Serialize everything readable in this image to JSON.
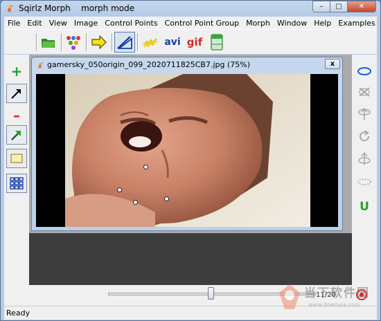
{
  "window": {
    "app_name": "Sqirlz Morph",
    "mode": "morph mode",
    "buttons": {
      "minimize": "–",
      "maximize": "□",
      "close": "✕"
    }
  },
  "menu": [
    "File",
    "Edit",
    "View",
    "Image",
    "Control Points",
    "Control Point Group",
    "Morph",
    "Window",
    "Help",
    "Examples"
  ],
  "toolbar": {
    "items": [
      {
        "icon": "open-folder-icon"
      },
      {
        "icon": "color-dots-icon"
      },
      {
        "icon": "arrow-right-icon"
      },
      {
        "icon": "warp-mode-icon",
        "pressed": true
      },
      {
        "icon": "spark-effect-icon"
      },
      {
        "icon": "avi-export-icon",
        "label": "avi"
      },
      {
        "icon": "gif-export-icon",
        "label": "gif"
      },
      {
        "icon": "panel-icon"
      }
    ]
  },
  "left_tools": [
    {
      "icon": "add-point-icon",
      "label": "+"
    },
    {
      "icon": "select-arrow-icon"
    },
    {
      "icon": "remove-point-icon",
      "label": "–"
    },
    {
      "icon": "move-point-icon"
    },
    {
      "icon": "rectangle-icon"
    },
    {
      "icon": "grid-icon"
    }
  ],
  "right_tools": [
    {
      "icon": "ellipse-icon"
    },
    {
      "icon": "delete-group-icon"
    },
    {
      "icon": "move-up-icon"
    },
    {
      "icon": "rotate-icon"
    },
    {
      "icon": "scale-icon"
    },
    {
      "icon": "dotted-ellipse-icon"
    },
    {
      "icon": "u-shape-icon",
      "label": "U"
    }
  ],
  "document": {
    "title": "gamersky_050origin_099_2020711825CB7.jpg  (75%)",
    "close": "x"
  },
  "timeline": {
    "frame": 11,
    "total": 20,
    "frame_label": "11/20"
  },
  "status": "Ready",
  "watermark": {
    "text": "当下软件园",
    "url": "www.downxia.com"
  }
}
